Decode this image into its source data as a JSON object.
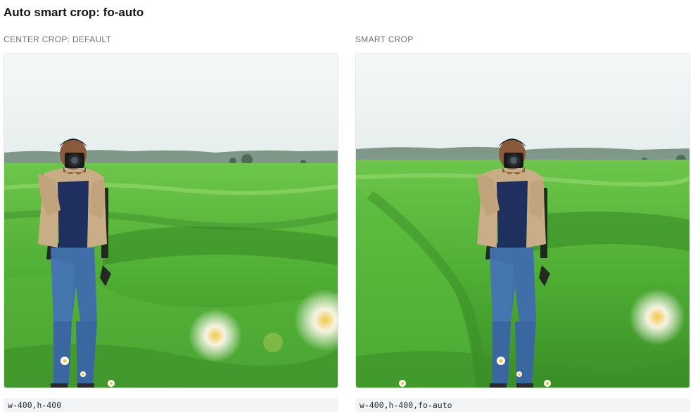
{
  "page": {
    "title": "Auto smart crop: fo-auto"
  },
  "examples": [
    {
      "label": "CENTER CROP: DEFAULT",
      "image_subject": "photographer-in-rice-field",
      "transform": "w-400,h-400"
    },
    {
      "label": "SMART CROP",
      "image_subject": "photographer-in-rice-field",
      "transform": "w-400,h-400,fo-auto"
    }
  ],
  "colors": {
    "sky": "#eef3f4",
    "field_light": "#7fcf5a",
    "field_dark": "#3f9a2b",
    "tree_line": "#5f7d6a",
    "jacket": "#c8ad86",
    "jeans": "#3f6ea8",
    "code_bg": "#f3f4f6",
    "label_text": "#6b7280"
  }
}
